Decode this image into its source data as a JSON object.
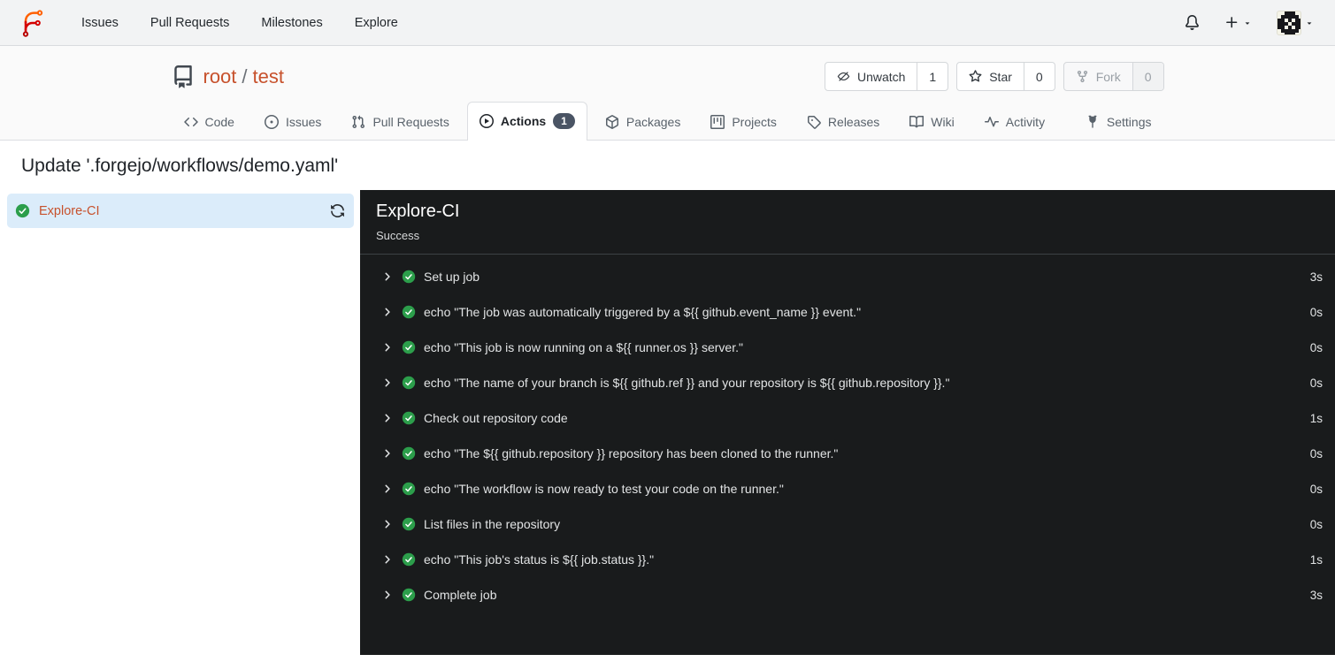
{
  "topnav": {
    "items": [
      "Issues",
      "Pull Requests",
      "Milestones",
      "Explore"
    ]
  },
  "repo": {
    "owner": "root",
    "separator": "/",
    "name": "test",
    "watch": {
      "label": "Unwatch",
      "count": "1"
    },
    "star": {
      "label": "Star",
      "count": "0"
    },
    "fork": {
      "label": "Fork",
      "count": "0"
    }
  },
  "tabs": {
    "code": "Code",
    "issues": "Issues",
    "pulls": "Pull Requests",
    "actions": "Actions",
    "actions_badge": "1",
    "packages": "Packages",
    "projects": "Projects",
    "releases": "Releases",
    "wiki": "Wiki",
    "activity": "Activity",
    "settings": "Settings"
  },
  "page": {
    "title": "Update '.forgejo/workflows/demo.yaml'"
  },
  "sidebar": {
    "job_name": "Explore-CI"
  },
  "panel": {
    "title": "Explore-CI",
    "status": "Success",
    "steps": [
      {
        "label": "Set up job",
        "duration": "3s"
      },
      {
        "label": "echo \"The job was automatically triggered by a ${{ github.event_name }} event.\"",
        "duration": "0s"
      },
      {
        "label": "echo \"This job is now running on a ${{ runner.os }} server.\"",
        "duration": "0s"
      },
      {
        "label": "echo \"The name of your branch is ${{ github.ref }} and your repository is ${{ github.repository }}.\"",
        "duration": "0s"
      },
      {
        "label": "Check out repository code",
        "duration": "1s"
      },
      {
        "label": "echo \"The ${{ github.repository }} repository has been cloned to the runner.\"",
        "duration": "0s"
      },
      {
        "label": "echo \"The workflow is now ready to test your code on the runner.\"",
        "duration": "0s"
      },
      {
        "label": "List files in the repository",
        "duration": "0s"
      },
      {
        "label": "echo \"This job's status is ${{ job.status }}.\"",
        "duration": "1s"
      },
      {
        "label": "Complete job",
        "duration": "3s"
      }
    ]
  },
  "colors": {
    "primary_orange": "#c7512c",
    "success_green": "#2c9e4b",
    "panel_background": "#191b1c",
    "selected_job_background": "#dbecfa",
    "badge_background": "#4a5464"
  }
}
